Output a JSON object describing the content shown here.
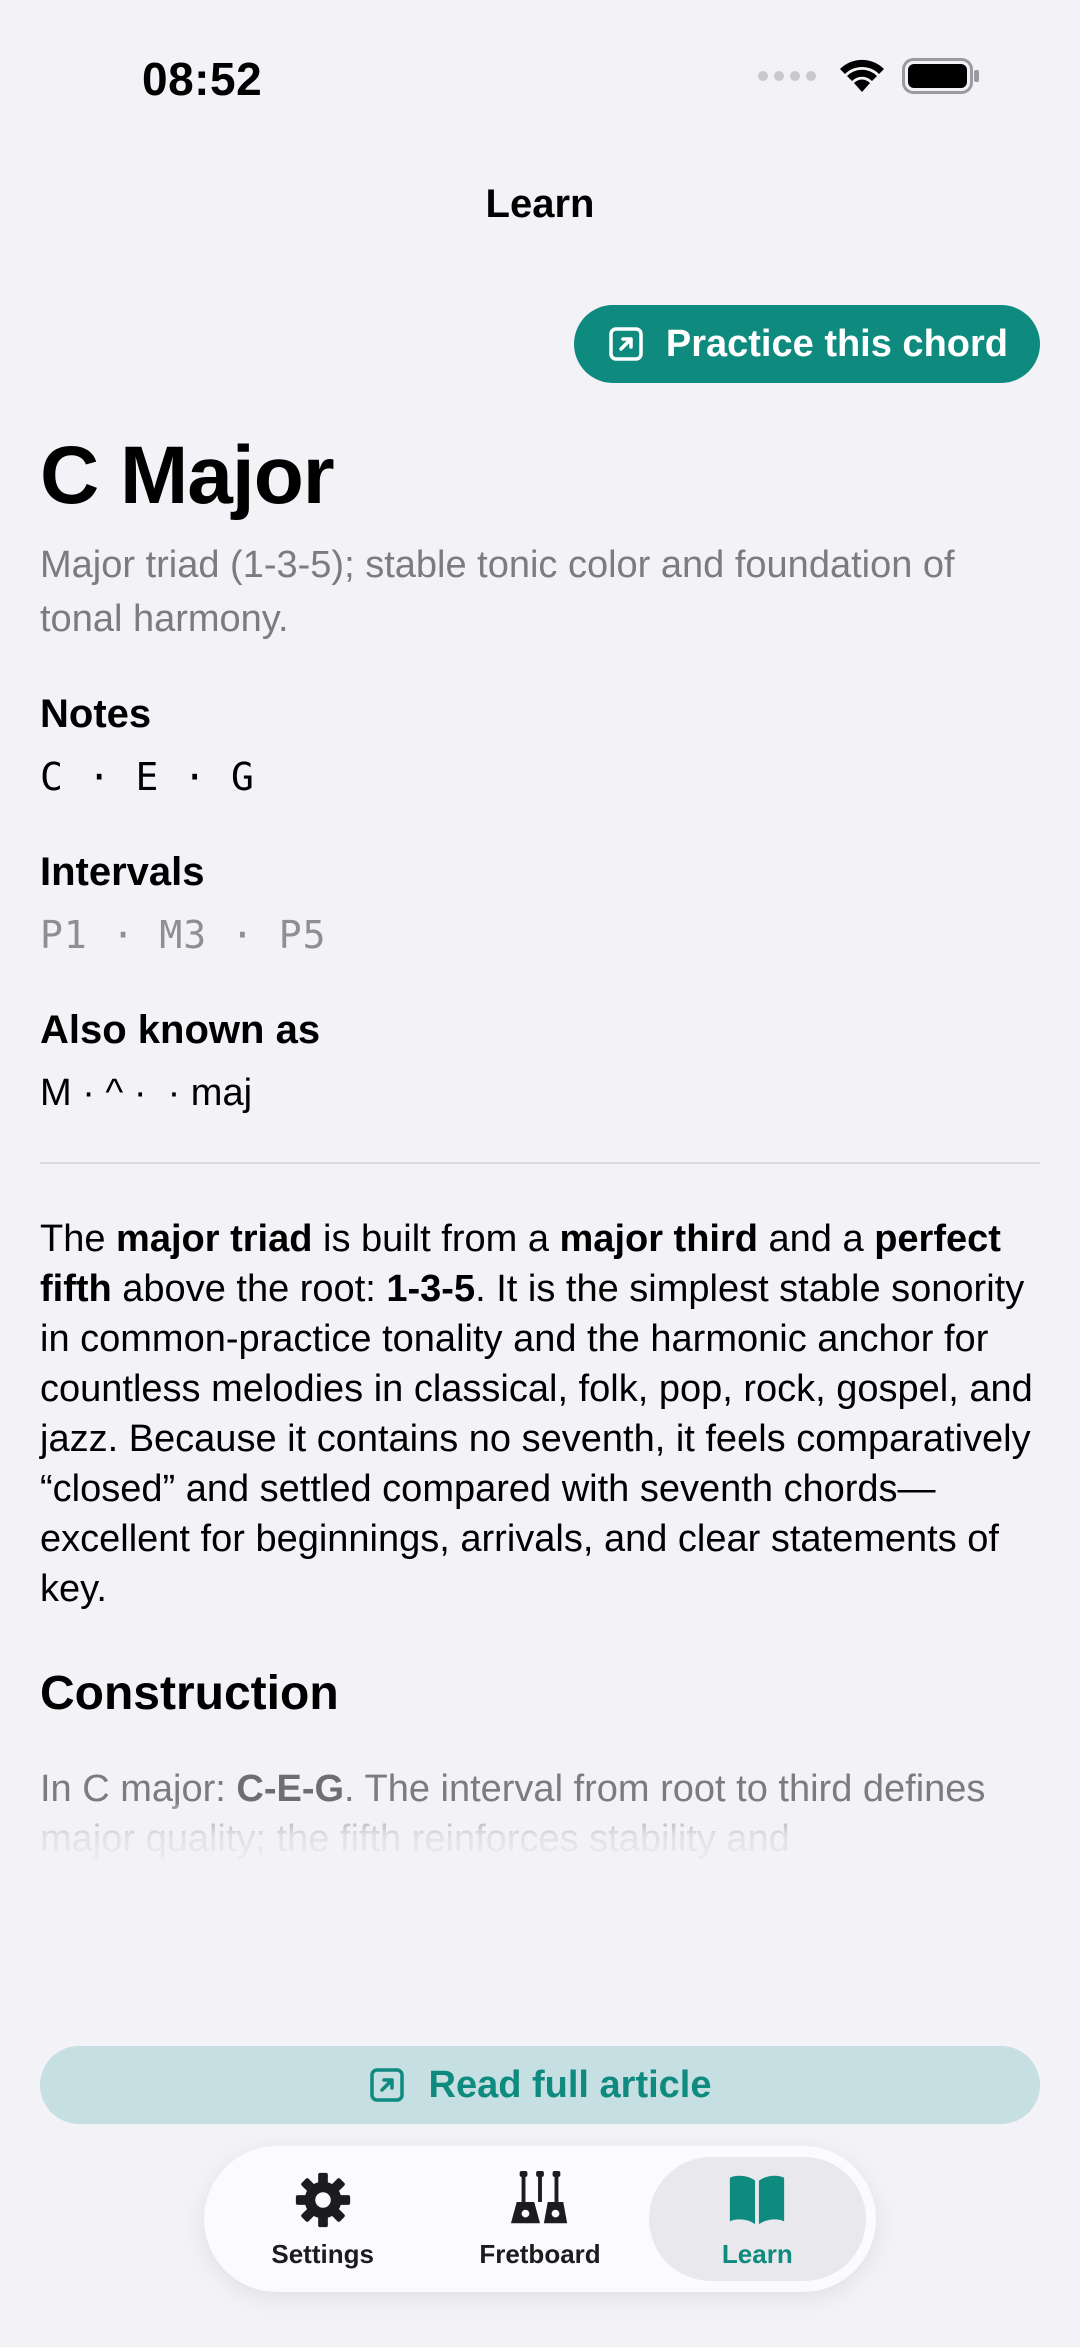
{
  "status_bar": {
    "time": "08:52"
  },
  "nav": {
    "title": "Learn"
  },
  "actions": {
    "practice_label": "Practice this chord",
    "read_article_label": "Read full article"
  },
  "chord": {
    "name": "C Major",
    "description": "Major triad (1-3-5); stable tonic color and foundation of tonal harmony.",
    "notes_label": "Notes",
    "notes": "C · E · G",
    "intervals_label": "Intervals",
    "intervals": "P1 · M3 · P5",
    "aka_label": "Also known as",
    "aka": "M · ^ ·  · maj"
  },
  "article": {
    "p1": {
      "t1": "The ",
      "b1": "major triad",
      "t2": " is built from a ",
      "b2": "major third",
      "t3": " and a ",
      "b3": "perfect fifth",
      "t4": " above the root: ",
      "b4": "1-3-5",
      "t5": ". It is the simplest stable sonority in common-practice tonality and the harmonic anchor for countless melodies in classical, folk, pop, rock, gospel, and jazz. Because it contains no seventh, it feels comparatively “closed” and settled compared with seventh chords—excellent for beginnings, arrivals, and clear statements of key."
    },
    "construction_heading": "Construction",
    "construction": {
      "t1": "In C major: ",
      "b1": "C-E-G",
      "t2": ". The interval from root to third defines major quality; the fifth reinforces stability and"
    }
  },
  "tabbar": {
    "tabs": [
      {
        "label": "Settings",
        "icon": "gear-icon",
        "active": false
      },
      {
        "label": "Fretboard",
        "icon": "guitars-icon",
        "active": false
      },
      {
        "label": "Learn",
        "icon": "book-icon",
        "active": true
      }
    ]
  },
  "colors": {
    "accent": "#0f8a7e",
    "accent_soft": "#c5dfe2",
    "background": "#f2f2f7"
  }
}
